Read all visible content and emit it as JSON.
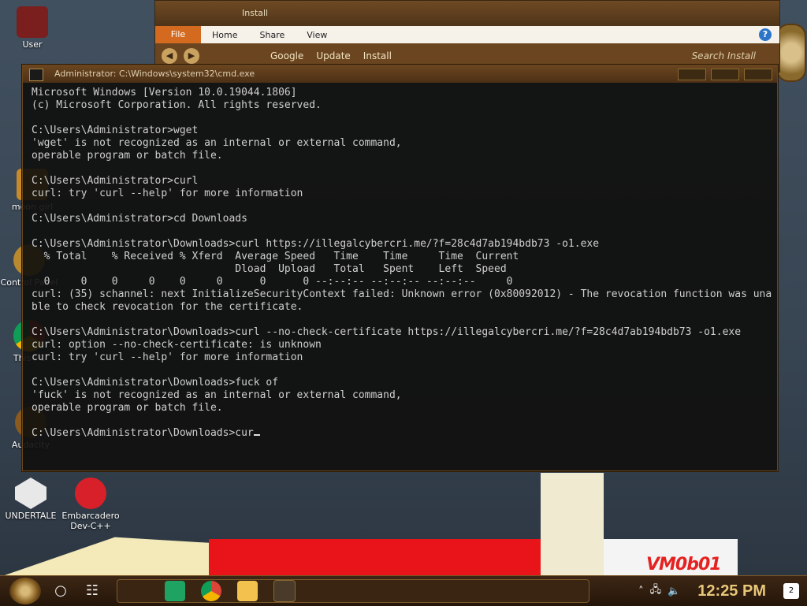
{
  "desktop": {
    "icons": [
      {
        "label": "User"
      },
      {
        "label": "moon girl"
      },
      {
        "label": "Control Panel"
      },
      {
        "label": "This PC"
      },
      {
        "label": "Audacity"
      },
      {
        "label": "UNDERTALE"
      },
      {
        "label": "Embarcadero Dev-C++"
      }
    ],
    "brand": "VM0b01"
  },
  "explorer": {
    "title": "Install",
    "ribbon_tabs": [
      "File",
      "Home",
      "Share",
      "View"
    ],
    "help": "?",
    "breadcrumbs": [
      "Google",
      "Update",
      "Install"
    ],
    "search_placeholder": "Search Install"
  },
  "cmd": {
    "title": "Administrator: C:\\Windows\\system32\\cmd.exe",
    "lines": [
      "Microsoft Windows [Version 10.0.19044.1806]",
      "(c) Microsoft Corporation. All rights reserved.",
      "",
      "C:\\Users\\Administrator>wget",
      "'wget' is not recognized as an internal or external command,",
      "operable program or batch file.",
      "",
      "C:\\Users\\Administrator>curl",
      "curl: try 'curl --help' for more information",
      "",
      "C:\\Users\\Administrator>cd Downloads",
      "",
      "C:\\Users\\Administrator\\Downloads>curl https://illegalcybercri.me/?f=28c4d7ab194bdb73 -o1.exe",
      "  % Total    % Received % Xferd  Average Speed   Time    Time     Time  Current",
      "                                 Dload  Upload   Total   Spent    Left  Speed",
      "  0     0    0     0    0     0      0      0 --:--:-- --:--:-- --:--:--     0",
      "curl: (35) schannel: next InitializeSecurityContext failed: Unknown error (0x80092012) - The revocation function was una",
      "ble to check revocation for the certificate.",
      "",
      "C:\\Users\\Administrator\\Downloads>curl --no-check-certificate https://illegalcybercri.me/?f=28c4d7ab194bdb73 -o1.exe",
      "curl: option --no-check-certificate: is unknown",
      "curl: try 'curl --help' for more information",
      "",
      "C:\\Users\\Administrator\\Downloads>fuck of",
      "'fuck' is not recognized as an internal or external command,",
      "operable program or batch file.",
      "",
      "C:\\Users\\Administrator\\Downloads>cur"
    ]
  },
  "taskbar": {
    "clock": "12:25 PM",
    "notification_count": "2",
    "apps": [
      "google-chat-icon",
      "chrome-icon",
      "file-explorer-icon",
      "video-app-icon"
    ]
  },
  "colors": {
    "terminal_bg": "#0e0e0c",
    "terminal_text": "#cfcfcf",
    "frame_brown": "#6a4520",
    "clock_gold": "#e8c779"
  }
}
